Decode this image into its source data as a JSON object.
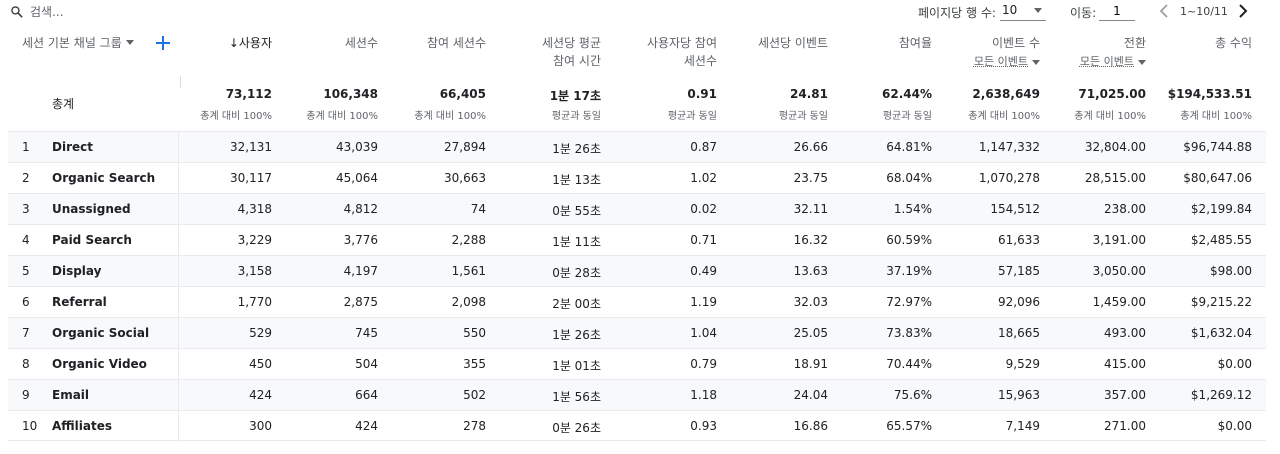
{
  "toolbar": {
    "search_placeholder": "검색...",
    "rows_per_page_label": "페이지당 행 수:",
    "rows_per_page_value": "10",
    "goto_label": "이동:",
    "goto_value": "1",
    "range_text": "1~10/11"
  },
  "header": {
    "dimension": "세션 기본 채널 그룹",
    "sort_arrow": "↓",
    "columns": [
      {
        "line1": "사용자",
        "line2": ""
      },
      {
        "line1": "세션수",
        "line2": ""
      },
      {
        "line1": "참여 세션수",
        "line2": ""
      },
      {
        "line1": "세션당 평균",
        "line2": "참여 시간"
      },
      {
        "line1": "사용자당 참여",
        "line2": "세션수"
      },
      {
        "line1": "세션당 이벤트",
        "line2": ""
      },
      {
        "line1": "참여율",
        "line2": ""
      },
      {
        "line1": "이벤트 수",
        "line2": "",
        "sub": "모든 이벤트"
      },
      {
        "line1": "전환",
        "line2": "",
        "sub": "모든 이벤트"
      },
      {
        "line1": "총 수익",
        "line2": ""
      }
    ]
  },
  "totals": {
    "label": "총계",
    "values": [
      "73,112",
      "106,348",
      "66,405",
      "1분 17초",
      "0.91",
      "24.81",
      "62.44%",
      "2,638,649",
      "71,025.00",
      "$194,533.51"
    ],
    "subs": [
      "총계 대비 100%",
      "총계 대비 100%",
      "총계 대비 100%",
      "평균과 동일",
      "평균과 동일",
      "평균과 동일",
      "평균과 동일",
      "총계 대비 100%",
      "총계 대비 100%",
      "총계 대비 100%"
    ]
  },
  "rows": [
    {
      "idx": "1",
      "name": "Direct",
      "v": [
        "32,131",
        "43,039",
        "27,894",
        "1분 26초",
        "0.87",
        "26.66",
        "64.81%",
        "1,147,332",
        "32,804.00",
        "$96,744.88"
      ]
    },
    {
      "idx": "2",
      "name": "Organic Search",
      "v": [
        "30,117",
        "45,064",
        "30,663",
        "1분 13초",
        "1.02",
        "23.75",
        "68.04%",
        "1,070,278",
        "28,515.00",
        "$80,647.06"
      ]
    },
    {
      "idx": "3",
      "name": "Unassigned",
      "v": [
        "4,318",
        "4,812",
        "74",
        "0분 55초",
        "0.02",
        "32.11",
        "1.54%",
        "154,512",
        "238.00",
        "$2,199.84"
      ]
    },
    {
      "idx": "4",
      "name": "Paid Search",
      "v": [
        "3,229",
        "3,776",
        "2,288",
        "1분 11초",
        "0.71",
        "16.32",
        "60.59%",
        "61,633",
        "3,191.00",
        "$2,485.55"
      ]
    },
    {
      "idx": "5",
      "name": "Display",
      "v": [
        "3,158",
        "4,197",
        "1,561",
        "0분 28초",
        "0.49",
        "13.63",
        "37.19%",
        "57,185",
        "3,050.00",
        "$98.00"
      ]
    },
    {
      "idx": "6",
      "name": "Referral",
      "v": [
        "1,770",
        "2,875",
        "2,098",
        "2분 00초",
        "1.19",
        "32.03",
        "72.97%",
        "92,096",
        "1,459.00",
        "$9,215.22"
      ]
    },
    {
      "idx": "7",
      "name": "Organic Social",
      "v": [
        "529",
        "745",
        "550",
        "1분 26초",
        "1.04",
        "25.05",
        "73.83%",
        "18,665",
        "493.00",
        "$1,632.04"
      ]
    },
    {
      "idx": "8",
      "name": "Organic Video",
      "v": [
        "450",
        "504",
        "355",
        "1분 01초",
        "0.79",
        "18.91",
        "70.44%",
        "9,529",
        "415.00",
        "$0.00"
      ]
    },
    {
      "idx": "9",
      "name": "Email",
      "v": [
        "424",
        "664",
        "502",
        "1분 56초",
        "1.18",
        "24.04",
        "75.6%",
        "15,963",
        "357.00",
        "$1,269.12"
      ]
    },
    {
      "idx": "10",
      "name": "Affiliates",
      "v": [
        "300",
        "424",
        "278",
        "0분 26초",
        "0.93",
        "16.86",
        "65.57%",
        "7,149",
        "271.00",
        "$0.00"
      ]
    }
  ]
}
